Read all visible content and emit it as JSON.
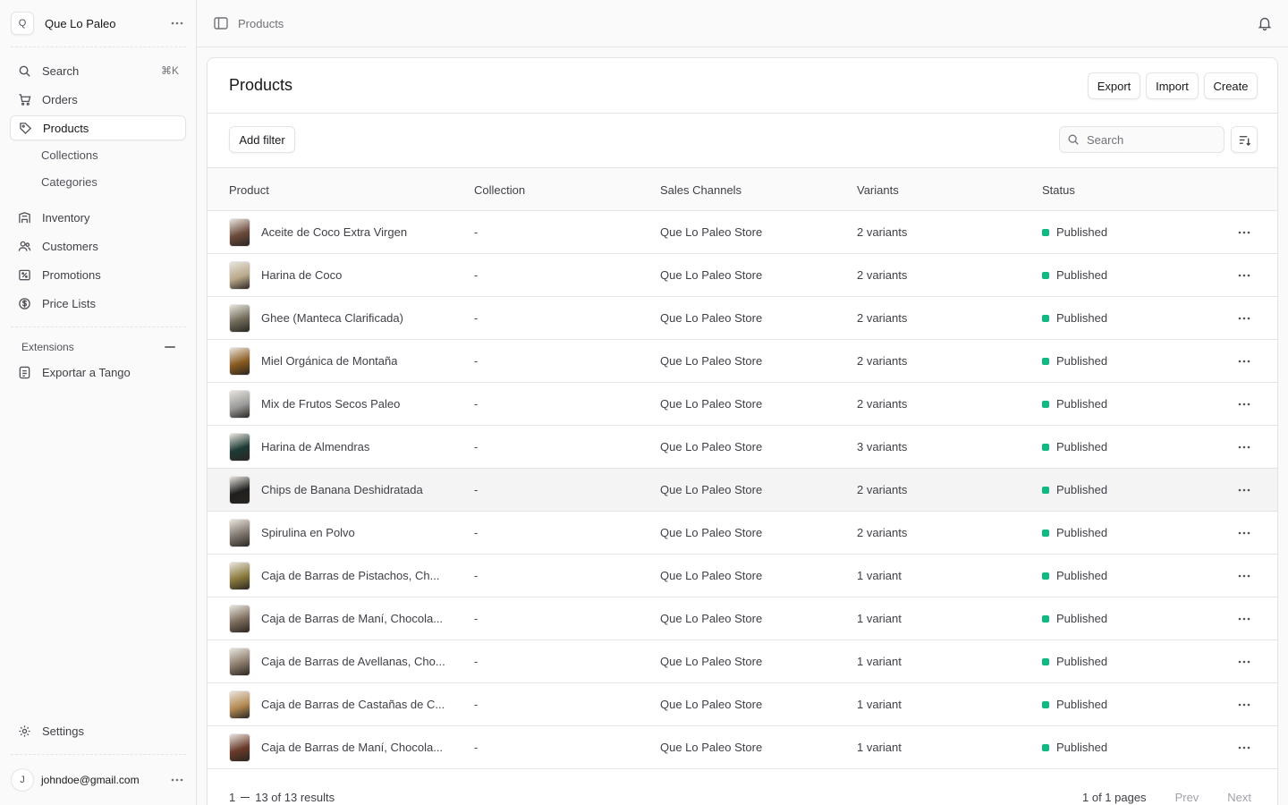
{
  "store": {
    "initial": "Q",
    "name": "Que Lo Paleo"
  },
  "nav": {
    "search": {
      "label": "Search",
      "shortcut": "⌘K"
    },
    "orders": "Orders",
    "products": "Products",
    "collections": "Collections",
    "categories": "Categories",
    "inventory": "Inventory",
    "customers": "Customers",
    "promotions": "Promotions",
    "price_lists": "Price Lists",
    "extensions_label": "Extensions",
    "exportar": "Exportar a Tango",
    "settings": "Settings"
  },
  "user": {
    "initial": "J",
    "email": "johndoe@gmail.com"
  },
  "topbar": {
    "breadcrumb": "Products"
  },
  "page": {
    "title": "Products",
    "export": "Export",
    "import": "Import",
    "create": "Create",
    "add_filter": "Add filter",
    "search_placeholder": "Search"
  },
  "table": {
    "headers": {
      "product": "Product",
      "collection": "Collection",
      "channels": "Sales Channels",
      "variants": "Variants",
      "status": "Status"
    },
    "rows": [
      {
        "name": "Aceite de Coco Extra Virgen",
        "collection": "-",
        "channel": "Que Lo Paleo Store",
        "variants": "2 variants",
        "status": "Published",
        "thumb": "#6b4a3a"
      },
      {
        "name": "Harina de Coco",
        "collection": "-",
        "channel": "Que Lo Paleo Store",
        "variants": "2 variants",
        "status": "Published",
        "thumb": "#b9a88a"
      },
      {
        "name": "Ghee (Manteca Clarificada)",
        "collection": "-",
        "channel": "Que Lo Paleo Store",
        "variants": "2 variants",
        "status": "Published",
        "thumb": "#6f6a58"
      },
      {
        "name": "Miel Orgánica de Montaña",
        "collection": "-",
        "channel": "Que Lo Paleo Store",
        "variants": "2 variants",
        "status": "Published",
        "thumb": "#8a5a1e"
      },
      {
        "name": "Mix de Frutos Secos Paleo",
        "collection": "-",
        "channel": "Que Lo Paleo Store",
        "variants": "2 variants",
        "status": "Published",
        "thumb": "#9a9a9a"
      },
      {
        "name": "Harina de Almendras",
        "collection": "-",
        "channel": "Que Lo Paleo Store",
        "variants": "3 variants",
        "status": "Published",
        "thumb": "#1d3a34"
      },
      {
        "name": "Chips de Banana Deshidratada",
        "collection": "-",
        "channel": "Que Lo Paleo Store",
        "variants": "2 variants",
        "status": "Published",
        "thumb": "#1f1f1f"
      },
      {
        "name": "Spirulina en Polvo",
        "collection": "-",
        "channel": "Que Lo Paleo Store",
        "variants": "2 variants",
        "status": "Published",
        "thumb": "#7d746c"
      },
      {
        "name": "Caja de Barras de Pistachos, Ch...",
        "collection": "-",
        "channel": "Que Lo Paleo Store",
        "variants": "1 variant",
        "status": "Published",
        "thumb": "#8a7a3c"
      },
      {
        "name": "Caja de Barras de Maní, Chocola...",
        "collection": "-",
        "channel": "Que Lo Paleo Store",
        "variants": "1 variant",
        "status": "Published",
        "thumb": "#7a6a5a"
      },
      {
        "name": "Caja de Barras de Avellanas, Cho...",
        "collection": "-",
        "channel": "Que Lo Paleo Store",
        "variants": "1 variant",
        "status": "Published",
        "thumb": "#8a7a6a"
      },
      {
        "name": "Caja de Barras de Castañas de C...",
        "collection": "-",
        "channel": "Que Lo Paleo Store",
        "variants": "1 variant",
        "status": "Published",
        "thumb": "#b58a52"
      },
      {
        "name": "Caja de Barras de Maní, Chocola...",
        "collection": "-",
        "channel": "Que Lo Paleo Store",
        "variants": "1 variant",
        "status": "Published",
        "thumb": "#6a3a2a"
      }
    ]
  },
  "footer": {
    "range_start": "1",
    "range_rest": "13 of 13 results",
    "pages": "1 of 1 pages",
    "prev": "Prev",
    "next": "Next"
  },
  "colors": {
    "status_published": "#10b981",
    "hover_row": "#f4f4f5"
  }
}
